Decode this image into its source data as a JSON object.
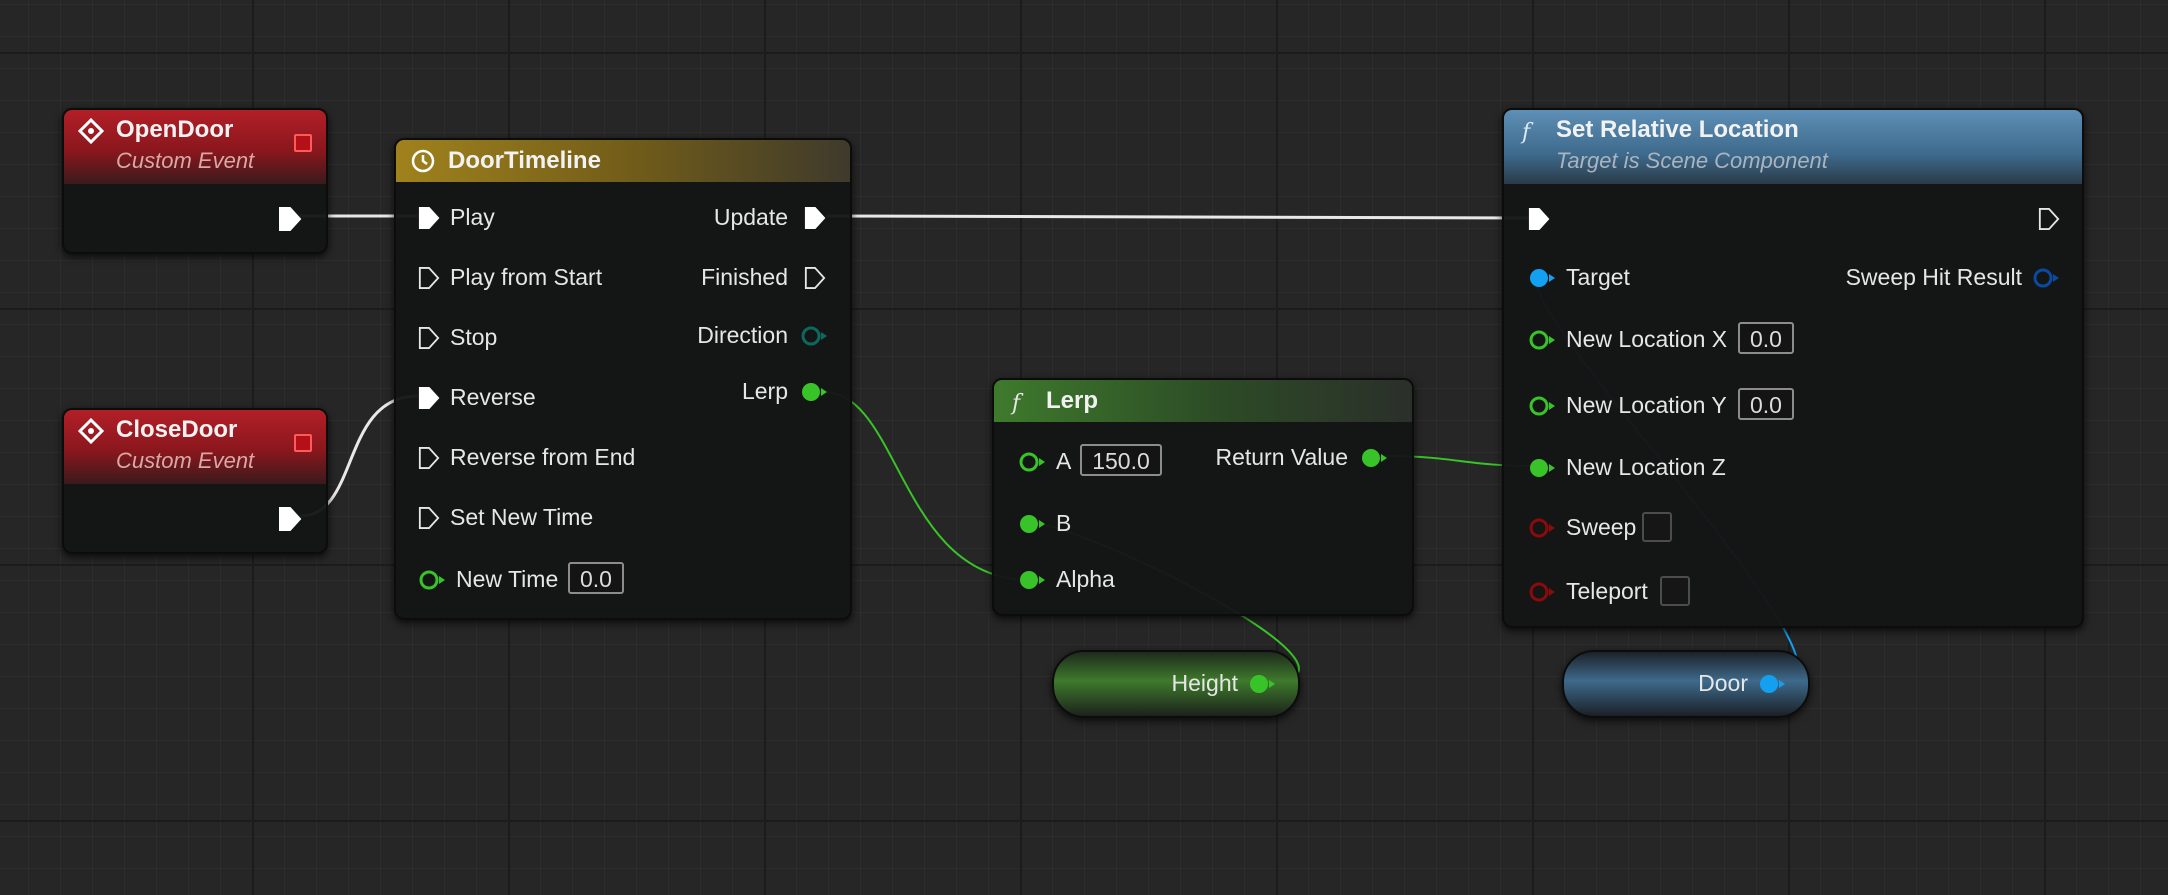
{
  "colors": {
    "event_header": "#b31f27",
    "timeline_header": "#a0821c",
    "function_header_pure": "#3e7a2c",
    "function_header_impure": "#5e8fb6",
    "exec_wire": "#e8e8e8",
    "float_pin": "#38c428",
    "object_pin": "#13a0f0",
    "bool_pin": "#8c0a0a",
    "struct_pin": "#0a4aa0",
    "canvas": "#262626"
  },
  "nodes": {
    "open_door": {
      "title": "OpenDoor",
      "subtitle": "Custom Event",
      "icon": "event-diamond-icon"
    },
    "close_door": {
      "title": "CloseDoor",
      "subtitle": "Custom Event",
      "icon": "event-diamond-icon"
    },
    "door_timeline": {
      "title": "DoorTimeline",
      "icon": "clock-icon",
      "inputs": [
        "Play",
        "Play from Start",
        "Stop",
        "Reverse",
        "Reverse from End",
        "Set New Time",
        "New Time"
      ],
      "outputs": [
        "Update",
        "Finished",
        "Direction",
        "Lerp"
      ],
      "new_time_value": "0.0"
    },
    "lerp": {
      "title": "Lerp",
      "icon": "function-icon",
      "inputs": [
        "A",
        "B",
        "Alpha"
      ],
      "a_value": "150.0",
      "output": "Return Value"
    },
    "set_relative_location": {
      "title": "Set Relative Location",
      "subtitle": "Target is Scene Component",
      "icon": "function-icon",
      "inputs": [
        "Target",
        "New Location X",
        "New Location Y",
        "New Location Z",
        "Sweep",
        "Teleport"
      ],
      "output": "Sweep Hit Result",
      "x_value": "0.0",
      "y_value": "0.0",
      "sweep_checked": false,
      "teleport_checked": false
    },
    "height_var": {
      "label": "Height"
    },
    "door_var": {
      "label": "Door"
    }
  }
}
